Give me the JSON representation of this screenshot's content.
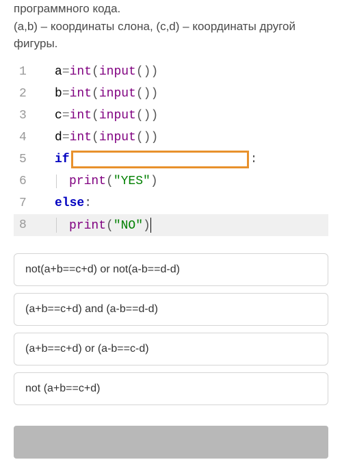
{
  "intro": {
    "line1_partial": "программного кода.",
    "line2": "(a,b) – координаты слона, (c,d) – координаты другой фигуры."
  },
  "code": {
    "lines": {
      "1": {
        "no": "1",
        "var": "a",
        "eq": "=",
        "fn": "int",
        "lp": "(",
        "inp": "input",
        "ip": "(",
        "cp": ")",
        "rp": ")"
      },
      "2": {
        "no": "2",
        "var": "b",
        "eq": "=",
        "fn": "int",
        "lp": "(",
        "inp": "input",
        "ip": "(",
        "cp": ")",
        "rp": ")"
      },
      "3": {
        "no": "3",
        "var": "c",
        "eq": "=",
        "fn": "int",
        "lp": "(",
        "inp": "input",
        "ip": "(",
        "cp": ")",
        "rp": ")"
      },
      "4": {
        "no": "4",
        "var": "d",
        "eq": "=",
        "fn": "int",
        "lp": "(",
        "inp": "input",
        "ip": "(",
        "cp": ")",
        "rp": ")"
      },
      "5": {
        "no": "5",
        "kw": "if",
        "colon": ":"
      },
      "6": {
        "no": "6",
        "fn": "print",
        "lp": "(",
        "str": "\"YES\"",
        "rp": ")"
      },
      "7": {
        "no": "7",
        "kw": "else",
        "colon": " :"
      },
      "8": {
        "no": "8",
        "fn": "print",
        "lp": "(",
        "str": "\"NO\"",
        "rp": ")"
      }
    }
  },
  "options": {
    "0": "not(a+b==c+d) or not(a-b==d-d)",
    "1": "(a+b==c+d) and (a-b==d-d)",
    "2": "(a+b==c+d) or (a-b==c-d)",
    "3": "not (a+b==c+d)"
  }
}
